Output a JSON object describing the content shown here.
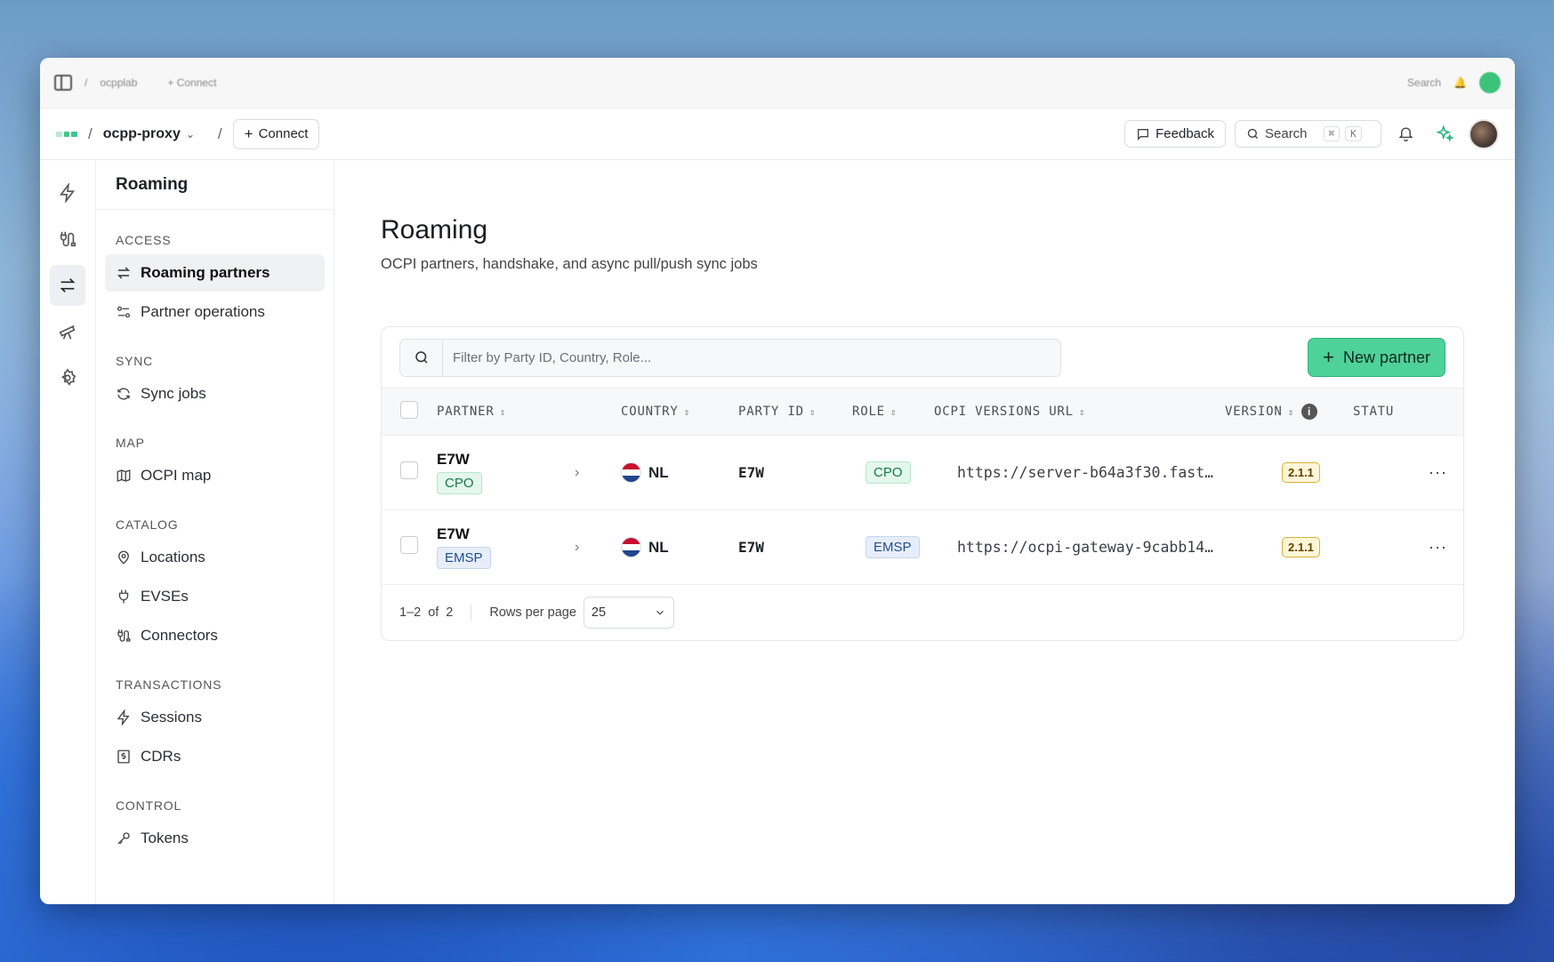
{
  "ghostbar": {
    "project": "ocpplab",
    "connect": "+ Connect",
    "search": "Search"
  },
  "header": {
    "project": "ocpp-proxy",
    "connect_label": "Connect",
    "feedback_label": "Feedback",
    "search_label": "Search",
    "search_kbd_cmd": "⌘",
    "search_kbd_key": "K"
  },
  "sidebar": {
    "title": "Roaming",
    "sections": {
      "access": "ACCESS",
      "sync": "SYNC",
      "map": "MAP",
      "catalog": "CATALOG",
      "transactions": "TRANSACTIONS",
      "control": "CONTROL"
    },
    "items": {
      "roaming_partners": "Roaming partners",
      "partner_operations": "Partner operations",
      "sync_jobs": "Sync jobs",
      "ocpi_map": "OCPI map",
      "locations": "Locations",
      "evses": "EVSEs",
      "connectors": "Connectors",
      "sessions": "Sessions",
      "cdrs": "CDRs",
      "tokens": "Tokens"
    }
  },
  "main": {
    "title": "Roaming",
    "subtitle": "OCPI partners, handshake, and async pull/push sync jobs",
    "filter_placeholder": "Filter by Party ID, Country, Role...",
    "new_partner_label": "New partner"
  },
  "table": {
    "columns": {
      "partner": "PARTNER",
      "country": "COUNTRY",
      "party_id": "PARTY ID",
      "role": "ROLE",
      "url": "OCPI VERSIONS URL",
      "version": "VERSION",
      "status": "STATU"
    },
    "rows": [
      {
        "partner": "E7W",
        "partner_role": "CPO",
        "country": "NL",
        "party_id": "E7W",
        "role": "CPO",
        "url": "https://server-b64a3f30.fast…",
        "version": "2.1.1"
      },
      {
        "partner": "E7W",
        "partner_role": "EMSP",
        "country": "NL",
        "party_id": "E7W",
        "role": "EMSP",
        "url": "https://ocpi-gateway-9cabb14…",
        "version": "2.1.1"
      }
    ]
  },
  "pager": {
    "range": "1–2",
    "of_label": "of",
    "total": "2",
    "rows_per_page_label": "Rows per page",
    "rows_per_page_value": "25"
  },
  "colors": {
    "accent": "#4fd19a",
    "flag_red": "#c8102e",
    "flag_blue": "#21468b"
  }
}
